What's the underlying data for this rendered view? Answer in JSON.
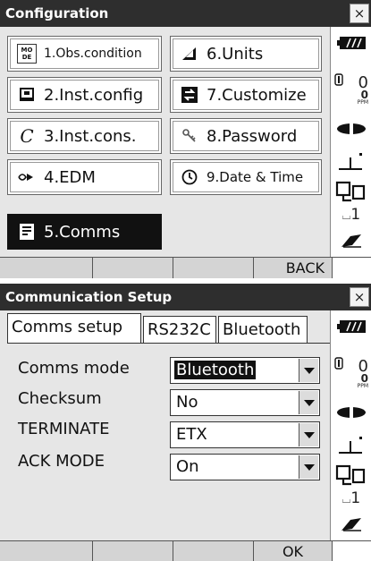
{
  "config": {
    "title": "Configuration",
    "close": "×",
    "menu": [
      {
        "num_label": "1.Obs.condition",
        "icon": "MO DE"
      },
      {
        "num_label": "2.Inst.config"
      },
      {
        "num_label": "3.Inst.cons.",
        "icon": "C"
      },
      {
        "num_label": "4.EDM"
      },
      {
        "num_label": "5.Comms"
      },
      {
        "num_label": "6.Units"
      },
      {
        "num_label": "7.Customize"
      },
      {
        "num_label": "8.Password"
      },
      {
        "num_label": "9.Date & Time"
      }
    ],
    "softkeys": [
      "",
      "",
      "",
      "BACK"
    ]
  },
  "comms": {
    "title": "Communication Setup",
    "close": "×",
    "tabs": [
      "Comms setup",
      "RS232C",
      "Bluetooth"
    ],
    "fields": [
      {
        "label": "Comms mode",
        "value": "Bluetooth"
      },
      {
        "label": "Checksum",
        "value": "No"
      },
      {
        "label": "TERMINATE",
        "value": "ETX"
      },
      {
        "label": "ACK MODE",
        "value": "On"
      }
    ],
    "softkeys": [
      "",
      "",
      "",
      "OK"
    ]
  },
  "status": {
    "ppm_value": "0",
    "ppm_unit": "PPM",
    "angle_value": "0",
    "page_indicator": "1"
  }
}
